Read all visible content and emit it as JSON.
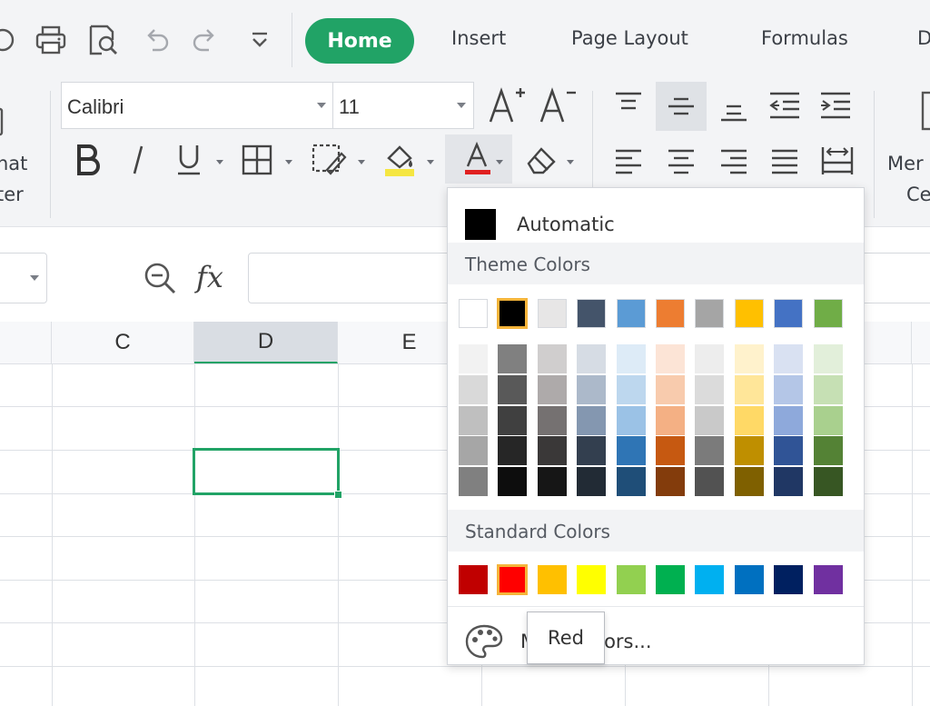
{
  "tabs": {
    "home": "Home",
    "insert": "Insert",
    "page_layout": "Page Layout",
    "formulas": "Formulas",
    "next_partial": "D"
  },
  "ribbon": {
    "font_name": "Calibri",
    "font_size": "11",
    "format_painter_line1": "nat",
    "format_painter_line2": "ter",
    "merge_line1": "Mer",
    "merge_line2": "Ce"
  },
  "formula_bar": {
    "fx_label": "fx",
    "value": ""
  },
  "grid": {
    "columns": [
      "C",
      "D",
      "E"
    ],
    "selected_column": "D"
  },
  "color_menu": {
    "automatic_label": "Automatic",
    "theme_colors_label": "Theme Colors",
    "standard_colors_label": "Standard Colors",
    "more_colors_label": "More Colors...",
    "theme_top_row": [
      "#FFFFFF",
      "#000000",
      "#E7E6E6",
      "#44546A",
      "#5B9BD5",
      "#ED7D31",
      "#A5A5A5",
      "#FFC000",
      "#4472C4",
      "#70AD47"
    ],
    "theme_shades": [
      [
        "#F2F2F2",
        "#808080",
        "#D0CECE",
        "#D6DCE4",
        "#DDEBF7",
        "#FCE4D6",
        "#EDEDED",
        "#FFF2CC",
        "#D9E1F2",
        "#E2EFDA"
      ],
      [
        "#D9D9D9",
        "#595959",
        "#AEAAAA",
        "#ACB9CA",
        "#BDD7EE",
        "#F8CBAD",
        "#DBDBDB",
        "#FFE699",
        "#B4C6E7",
        "#C6E0B4"
      ],
      [
        "#BFBFBF",
        "#404040",
        "#757171",
        "#8497B0",
        "#9BC2E6",
        "#F4B084",
        "#C9C9C9",
        "#FFD966",
        "#8EA9DB",
        "#A9D08E"
      ],
      [
        "#A6A6A6",
        "#262626",
        "#3A3838",
        "#333F4F",
        "#2F75B5",
        "#C65911",
        "#7B7B7B",
        "#BF8F00",
        "#305496",
        "#548235"
      ],
      [
        "#808080",
        "#0D0D0D",
        "#161616",
        "#222B35",
        "#1F4E78",
        "#833C0C",
        "#525252",
        "#7F6000",
        "#203764",
        "#375623"
      ]
    ],
    "standard": [
      "#C00000",
      "#FF0000",
      "#FFC000",
      "#FFFF00",
      "#92D050",
      "#00B050",
      "#00B0F0",
      "#0070C0",
      "#002060",
      "#7030A0"
    ],
    "selected_theme_index": 1,
    "selected_standard_index": 1
  },
  "tooltip": {
    "text": "Red"
  },
  "colors": {
    "accent": "#21A366",
    "font_color_underline": "#E02020",
    "highlight_fill": "#F5E642"
  }
}
